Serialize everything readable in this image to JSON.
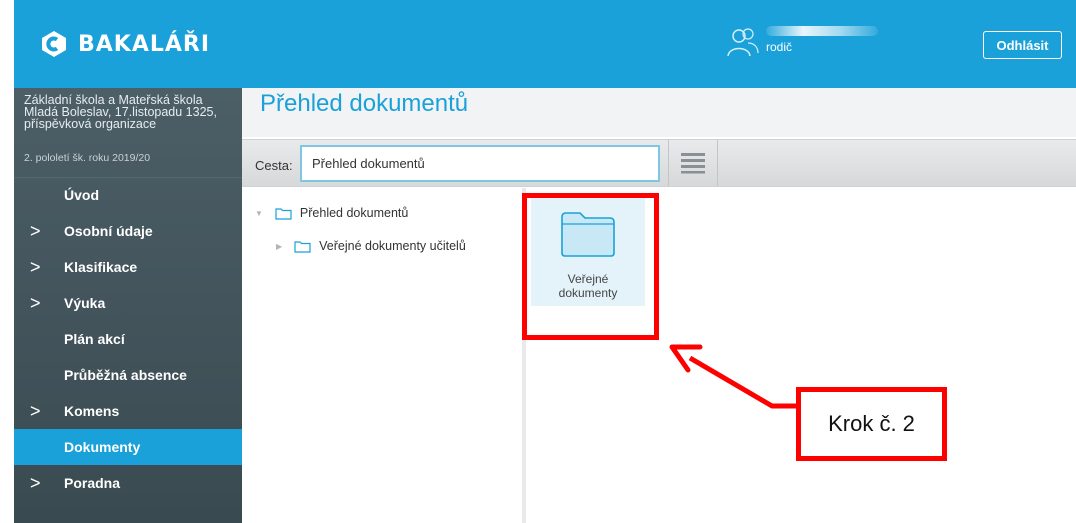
{
  "header": {
    "logo_text": "BAKALÁŘI",
    "user_role": "rodič",
    "logout_label": "Odhlásit"
  },
  "sidebar": {
    "school_name": "Základní škola a Mateřská škola Mladá Boleslav, 17.listopadu 1325, příspěvková organizace",
    "term": "2. pololetí šk. roku 2019/20",
    "items": [
      {
        "label": "Úvod",
        "has_submenu": false
      },
      {
        "label": "Osobní údaje",
        "has_submenu": true
      },
      {
        "label": "Klasifikace",
        "has_submenu": true
      },
      {
        "label": "Výuka",
        "has_submenu": true
      },
      {
        "label": "Plán akcí",
        "has_submenu": false
      },
      {
        "label": "Průběžná absence",
        "has_submenu": false
      },
      {
        "label": "Komens",
        "has_submenu": true
      },
      {
        "label": "Dokumenty",
        "has_submenu": false,
        "active": true
      },
      {
        "label": "Poradna",
        "has_submenu": true
      }
    ]
  },
  "main": {
    "title": "Přehled dokumentů",
    "path_label": "Cesta:",
    "path_value": "Přehled dokumentů",
    "tree": {
      "root": "Přehled dokumentů",
      "children": [
        "Veřejné dokumenty učitelů"
      ]
    },
    "tile": {
      "label_line1": "Veřejné",
      "label_line2": "dokumenty"
    }
  },
  "annotation": {
    "note": "Krok č. 2"
  },
  "colors": {
    "accent": "#1aa1d9",
    "sidebar": "#44555c",
    "annotation": "#ff0000",
    "folder_fill": "#c8e8f6",
    "folder_stroke": "#1aa1d9"
  },
  "icons": {
    "logo": "bakalari-logo-icon",
    "user": "users-icon",
    "view": "list-view-icon",
    "folder": "folder-icon",
    "chevron": "chevron-right-icon"
  }
}
